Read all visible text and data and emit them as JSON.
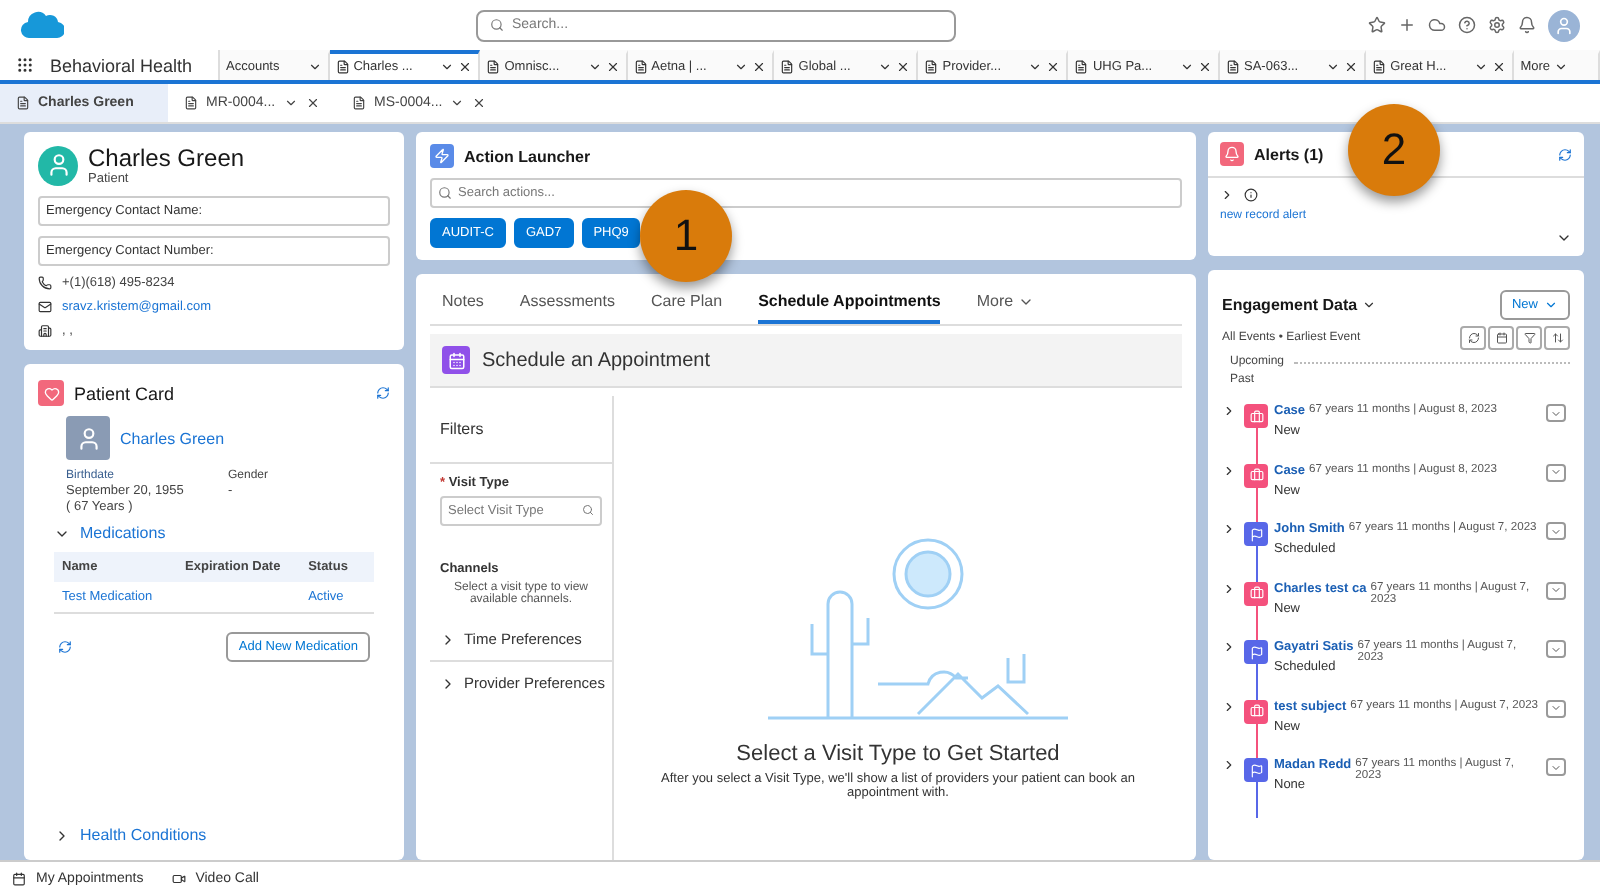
{
  "header": {
    "search_placeholder": "Search..."
  },
  "app_name": "Behavioral Health",
  "nav_tabs": [
    {
      "label": "Accounts",
      "kind": "object",
      "selected": false
    },
    {
      "label": "Charles ...",
      "kind": "record",
      "selected": true
    },
    {
      "label": "Omnisc...",
      "kind": "record",
      "selected": false
    },
    {
      "label": "Aetna | ...",
      "kind": "record",
      "selected": false
    },
    {
      "label": "Global ...",
      "kind": "record",
      "selected": false
    },
    {
      "label": "Provider...",
      "kind": "record",
      "selected": false
    },
    {
      "label": "UHG Pa...",
      "kind": "record",
      "selected": false
    },
    {
      "label": "SA-063...",
      "kind": "record",
      "selected": false
    },
    {
      "label": "Great H...",
      "kind": "record",
      "selected": false
    }
  ],
  "nav_more": "More",
  "subtabs": [
    {
      "label": "Charles Green",
      "selected": true
    },
    {
      "label": "MR-0004...",
      "selected": false
    },
    {
      "label": "MS-0004...",
      "selected": false
    }
  ],
  "patient": {
    "name": "Charles Green",
    "role": "Patient",
    "fields": [
      "Emergency Contact Name:",
      "Emergency Contact Number:"
    ],
    "phone": "+(1)(618) 495-8234",
    "email": "sravz.kristem@gmail.com",
    "address": ", ,"
  },
  "patient_card": {
    "title": "Patient Card",
    "name": "Charles Green",
    "birthdate_label": "Birthdate",
    "birthdate": "September 20, 1955",
    "age": "( 67 Years )",
    "gender_label": "Gender",
    "gender": "-",
    "medications": {
      "title": "Medications",
      "expanded": true,
      "columns": [
        "Name",
        "Expiration Date",
        "Status"
      ],
      "rows": [
        [
          "Test Medication",
          "",
          "Active"
        ]
      ],
      "add_button": "Add New Medication"
    },
    "health_conditions": {
      "title": "Health Conditions",
      "expanded": false
    }
  },
  "action_launcher": {
    "title": "Action Launcher",
    "placeholder": "Search actions...",
    "actions": [
      "AUDIT-C",
      "GAD7",
      "PHQ9"
    ]
  },
  "main_tabs": [
    {
      "label": "Notes",
      "selected": false
    },
    {
      "label": "Assessments",
      "selected": false
    },
    {
      "label": "Care Plan",
      "selected": false
    },
    {
      "label": "Schedule Appointments",
      "selected": true
    }
  ],
  "main_more": "More",
  "scheduler": {
    "title": "Schedule an Appointment",
    "filters_label": "Filters",
    "visit_type_label": "Visit Type",
    "required_mark": "*",
    "visit_type_placeholder": "Select Visit Type",
    "channels_label": "Channels",
    "channels_hint": "Select a visit type to view available channels.",
    "sections": [
      {
        "label": "Time Preferences",
        "expanded": false
      },
      {
        "label": "Provider Preferences",
        "expanded": false
      }
    ],
    "empty_title": "Select a Visit Type to Get Started",
    "empty_text": "After you select a Visit Type, we'll show a list of providers your patient can book an appointment with."
  },
  "alerts": {
    "title": "Alerts (1)",
    "link": "new record alert"
  },
  "engagement": {
    "title": "Engagement Data",
    "subtitle": "All Events • Earliest Event",
    "new_button": "New",
    "groups": [
      "Upcoming",
      "Past"
    ],
    "events": [
      {
        "kind": "case",
        "color": "#f4517d",
        "title": "Case",
        "status": "New",
        "time": "67 years 11 months | August 8, 2023"
      },
      {
        "kind": "case",
        "color": "#f4517d",
        "title": "Case",
        "status": "New",
        "time": "67 years 11 months | August 8, 2023"
      },
      {
        "kind": "appointment",
        "color": "#5867e8",
        "title": "John Smith",
        "status": "Scheduled",
        "time": "67 years 11 months | August 7, 2023"
      },
      {
        "kind": "case",
        "color": "#f4517d",
        "title": "Charles test ca",
        "status": "New",
        "time": "67 years 11 months | August 7, 2023"
      },
      {
        "kind": "appointment",
        "color": "#5867e8",
        "title": "Gayatri Satis",
        "status": "Scheduled",
        "time": "67 years 11 months | August 7, 2023"
      },
      {
        "kind": "case",
        "color": "#f4517d",
        "title": "test subject",
        "status": "New",
        "time": "67 years 11 months | August 7, 2023"
      },
      {
        "kind": "appointment",
        "color": "#5867e8",
        "title": "Madan Redd",
        "status": "None",
        "time": "67 years 11 months | August 7, 2023"
      }
    ]
  },
  "utility_bar": [
    "My Appointments",
    "Video Call"
  ],
  "callouts": [
    "1",
    "2"
  ]
}
